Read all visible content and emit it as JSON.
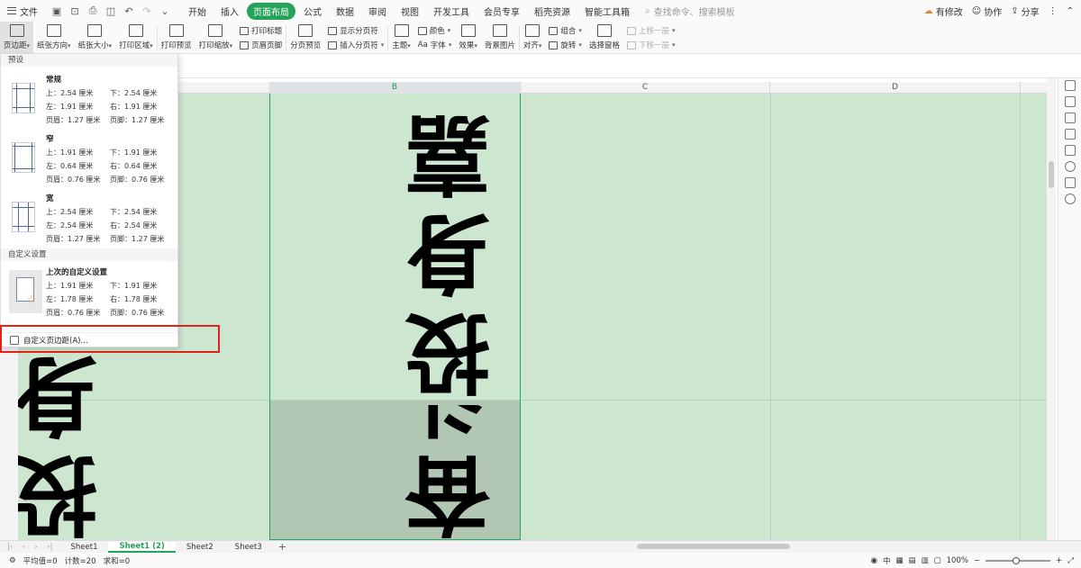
{
  "menubar": {
    "file": "文件",
    "tabs": [
      "开始",
      "插入",
      "页面布局",
      "公式",
      "数据",
      "审阅",
      "视图",
      "开发工具",
      "会员专享",
      "稻壳资源",
      "智能工具箱"
    ],
    "active_tab": "页面布局",
    "search": "查找命令、搜索模板",
    "right": {
      "changes": "有修改",
      "collab": "协作",
      "share": "分享"
    }
  },
  "ribbon": {
    "margins": "页边距",
    "orientation": "纸张方向",
    "size": "纸张大小",
    "print_area": "打印区域",
    "print_preview": "打印预览",
    "print_scale": "打印缩放",
    "print_titles": "打印标题",
    "header_footer": "页眉页脚",
    "page_break_preview": "分页预览",
    "show_page_break": "显示分页符",
    "insert_page_break": "插入分页符",
    "theme": "主题",
    "colors": "颜色",
    "fonts": "字体",
    "effects": "效果",
    "bg_image": "背景图片",
    "align": "对齐",
    "group": "组合",
    "rotate": "旋转",
    "selection_pane": "选择窗格",
    "bring_forward": "上移一层",
    "send_backward": "下移一层"
  },
  "columns": [
    "B",
    "C",
    "D"
  ],
  "sheet_text": {
    "col_b": "投身嘉兴",
    "col_b_lower": "奋斗嘉兴",
    "col_a": "投身嘉兴"
  },
  "dropdown": {
    "presets_title": "预设",
    "presets": [
      {
        "name": "常规",
        "top": "上：2.54 厘米",
        "bottom": "下：2.54 厘米",
        "left": "左：1.91 厘米",
        "right": "右：1.91 厘米",
        "header": "页眉：1.27 厘米",
        "footer": "页脚：1.27 厘米"
      },
      {
        "name": "窄",
        "top": "上：1.91 厘米",
        "bottom": "下：1.91 厘米",
        "left": "左：0.64 厘米",
        "right": "右：0.64 厘米",
        "header": "页眉：0.76 厘米",
        "footer": "页脚：0.76 厘米"
      },
      {
        "name": "宽",
        "top": "上：2.54 厘米",
        "bottom": "下：2.54 厘米",
        "left": "左：2.54 厘米",
        "right": "右：2.54 厘米",
        "header": "页眉：1.27 厘米",
        "footer": "页脚：1.27 厘米"
      }
    ],
    "custom_title": "自定义设置",
    "last_custom": {
      "name": "上次的自定义设置",
      "top": "上：1.91 厘米",
      "bottom": "下：1.91 厘米",
      "left": "左：1.78 厘米",
      "right": "右：1.78 厘米",
      "header": "页眉：0.76 厘米",
      "footer": "页脚：0.76 厘米"
    },
    "custom_margins": "自定义页边距(A)..."
  },
  "sheets": [
    "Sheet1",
    "Sheet1 (2)",
    "Sheet2",
    "Sheet3"
  ],
  "active_sheet": "Sheet1 (2)",
  "status": {
    "average": "平均值=0",
    "count": "计数=20",
    "sum": "求和=0",
    "zoom": "100%"
  }
}
